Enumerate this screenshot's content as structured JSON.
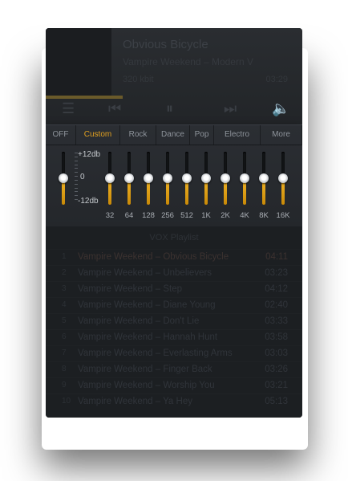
{
  "player": {
    "title": "Obvious Bicycle",
    "artist": "Vampire Weekend – Modern V",
    "info": "320 kbit",
    "time": "03:29"
  },
  "eq": {
    "presets": [
      "OFF",
      "Custom",
      "Rock",
      "Dance",
      "Pop",
      "Electro",
      "More"
    ],
    "active_preset": "Custom",
    "scale": {
      "top": "+12db",
      "mid": "0",
      "bottom": "-12db"
    },
    "accent_color": "#e0a020",
    "bands": [
      {
        "label": "32",
        "gain_db": 0
      },
      {
        "label": "64",
        "gain_db": 0
      },
      {
        "label": "128",
        "gain_db": 0
      },
      {
        "label": "256",
        "gain_db": 0
      },
      {
        "label": "512",
        "gain_db": 0
      },
      {
        "label": "1K",
        "gain_db": 0
      },
      {
        "label": "2K",
        "gain_db": 0
      },
      {
        "label": "4K",
        "gain_db": 0
      },
      {
        "label": "8K",
        "gain_db": 0
      },
      {
        "label": "16K",
        "gain_db": 0
      }
    ],
    "preamp_gain_db": 0
  },
  "playlist": {
    "title": "VOX Playlist",
    "tracks": [
      {
        "num": "1",
        "name": "Vampire Weekend – Obvious Bicycle",
        "time": "04:11"
      },
      {
        "num": "2",
        "name": "Vampire Weekend – Unbelievers",
        "time": "03:23"
      },
      {
        "num": "3",
        "name": "Vampire Weekend – Step",
        "time": "04:12"
      },
      {
        "num": "4",
        "name": "Vampire Weekend – Diane Young",
        "time": "02:40"
      },
      {
        "num": "5",
        "name": "Vampire Weekend – Don't Lie",
        "time": "03:33"
      },
      {
        "num": "6",
        "name": "Vampire Weekend – Hannah Hunt",
        "time": "03:58"
      },
      {
        "num": "7",
        "name": "Vampire Weekend – Everlasting Arms",
        "time": "03:03"
      },
      {
        "num": "8",
        "name": "Vampire Weekend – Finger Back",
        "time": "03:26"
      },
      {
        "num": "9",
        "name": "Vampire Weekend – Worship You",
        "time": "03:21"
      },
      {
        "num": "10",
        "name": "Vampire Weekend – Ya Hey",
        "time": "05:13"
      }
    ]
  }
}
